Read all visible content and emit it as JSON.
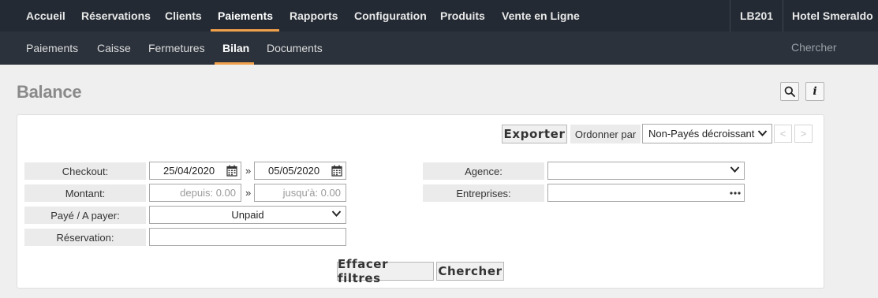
{
  "topnav": {
    "items": [
      "Accueil",
      "Réservations",
      "Clients",
      "Paiements",
      "Rapports",
      "Configuration",
      "Produits",
      "Vente en Ligne"
    ],
    "code": "LB201",
    "hotel": "Hotel Smeraldo"
  },
  "subnav": {
    "items": [
      "Paiements",
      "Caisse",
      "Fermetures",
      "Bilan",
      "Documents"
    ],
    "search": "Chercher"
  },
  "title": "Balance",
  "toolbar": {
    "export_label": "Exporter",
    "order_label": "Ordonner par",
    "order_value": "Non-Payés décroissant",
    "prev": "<",
    "next": ">"
  },
  "filters": {
    "checkout_label": "Checkout:",
    "checkout_from": "25/04/2020",
    "checkout_to": "05/05/2020",
    "montant_label": "Montant:",
    "montant_from_placeholder": "depuis: 0.00",
    "montant_to_placeholder": "jusqu'à: 0.00",
    "paye_label": "Payé / A payer:",
    "paye_value": "Unpaid",
    "reservation_label": "Réservation:",
    "reservation_value": "",
    "agence_label": "Agence:",
    "agence_value": "",
    "entreprises_label": "Entreprises:",
    "entreprises_value": "",
    "separator": "»"
  },
  "actions": {
    "clear_label": "Effacer filtres",
    "search_label": "Chercher"
  }
}
